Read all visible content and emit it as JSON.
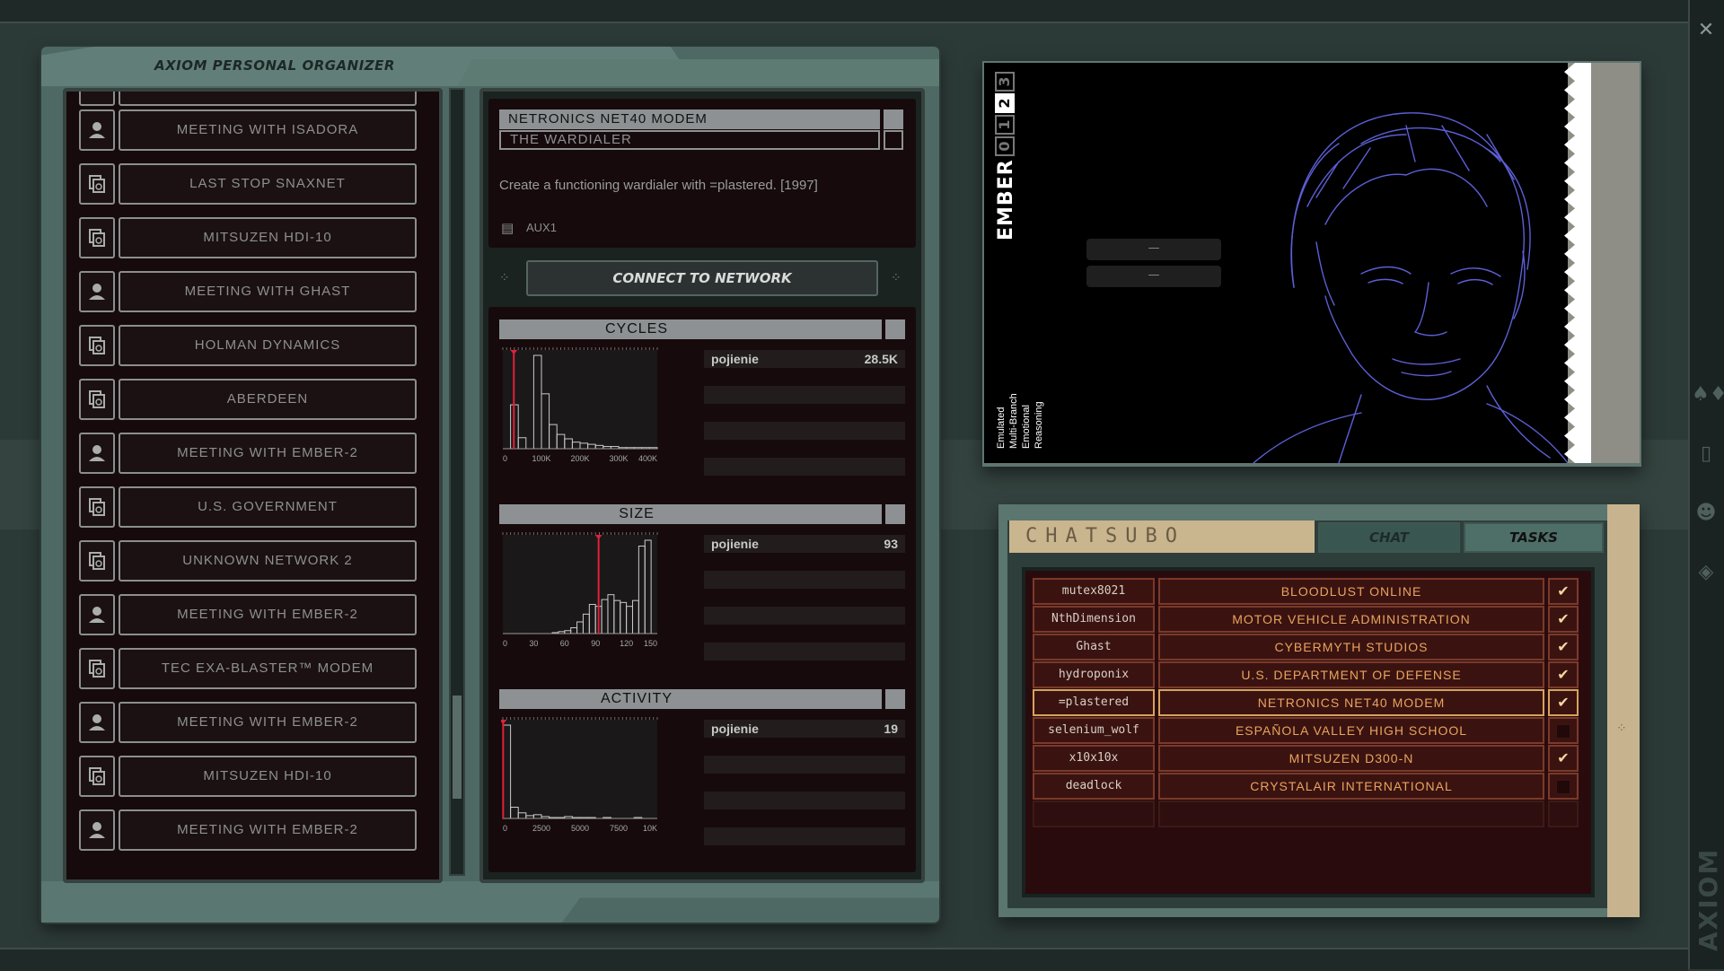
{
  "organizer": {
    "title": "AXIOM PERSONAL ORGANIZER",
    "items": [
      {
        "label": "MEETING WITH ISADORA",
        "icon": "person-icon"
      },
      {
        "label": "LAST STOP SNAXNET",
        "icon": "network-icon"
      },
      {
        "label": "MITSUZEN HDI-10",
        "icon": "network-icon"
      },
      {
        "label": "MEETING WITH GHAST",
        "icon": "person-icon"
      },
      {
        "label": "HOLMAN DYNAMICS",
        "icon": "network-icon"
      },
      {
        "label": "ABERDEEN",
        "icon": "network-icon"
      },
      {
        "label": "MEETING WITH EMBER-2",
        "icon": "person-icon"
      },
      {
        "label": "U.S. GOVERNMENT",
        "icon": "network-icon"
      },
      {
        "label": "UNKNOWN NETWORK 2",
        "icon": "network-icon"
      },
      {
        "label": "MEETING WITH EMBER-2",
        "icon": "person-icon"
      },
      {
        "label": "TEC EXA-BLASTER™ MODEM",
        "icon": "network-icon"
      },
      {
        "label": "MEETING WITH EMBER-2",
        "icon": "person-icon"
      },
      {
        "label": "MITSUZEN HDI-10",
        "icon": "network-icon"
      },
      {
        "label": "MEETING WITH EMBER-2",
        "icon": "person-icon"
      }
    ]
  },
  "task": {
    "selected": "NETRONICS NET40 MODEM",
    "secondary": "THE WARDIALER",
    "description": "Create a functioning wardialer with =plastered. [1997]",
    "aux": "AUX1",
    "connect_label": "CONNECT TO NETWORK"
  },
  "stats": {
    "cycles": {
      "title": "CYCLES",
      "name": "pojienie",
      "value": "28.5K"
    },
    "size": {
      "title": "SIZE",
      "name": "pojienie",
      "value": "93"
    },
    "activity": {
      "title": "ACTIVITY",
      "name": "pojienie",
      "value": "19"
    }
  },
  "chart_data": [
    {
      "type": "bar",
      "title": "CYCLES",
      "x_ticks": [
        "0",
        "100K",
        "200K",
        "300K",
        "400K"
      ],
      "xlim": [
        0,
        400000
      ],
      "bins": [
        0,
        40,
        10,
        0,
        85,
        50,
        22,
        13,
        9,
        6,
        5,
        4,
        3,
        2,
        2,
        1,
        1,
        1,
        1,
        1
      ],
      "marker": 28500
    },
    {
      "type": "bar",
      "title": "SIZE",
      "x_ticks": [
        "0",
        "30",
        "60",
        "90",
        "120",
        "150"
      ],
      "xlim": [
        0,
        150
      ],
      "bins": [
        0,
        0,
        0,
        0,
        0,
        0,
        0,
        0,
        1,
        2,
        3,
        6,
        12,
        20,
        30,
        28,
        35,
        40,
        34,
        32,
        28,
        34,
        90,
        96,
        0
      ],
      "marker": 93
    },
    {
      "type": "bar",
      "title": "ACTIVITY",
      "x_ticks": [
        "0",
        "2500",
        "5000",
        "7500",
        "10K"
      ],
      "xlim": [
        0,
        10000
      ],
      "bins": [
        100,
        12,
        6,
        3,
        4,
        2,
        1,
        1,
        2,
        1,
        1,
        1,
        0,
        1,
        0,
        0,
        0,
        1,
        0,
        0
      ],
      "marker": 19
    }
  ],
  "ember": {
    "name": "EMBER",
    "versions": [
      "0",
      "1",
      "2",
      "3"
    ],
    "active_version": "2",
    "traits": [
      "Emulated",
      "Multi-Branch",
      "Emotional",
      "Reasoning"
    ],
    "dash1": "—",
    "dash2": "—"
  },
  "chatsubo": {
    "title": "CHATSUBO",
    "tab_chat": "CHAT",
    "tab_tasks": "TASKS",
    "tasks": [
      {
        "user": "mutex8021",
        "target": "BLOODLUST ONLINE",
        "done": true
      },
      {
        "user": "NthDimension",
        "target": "MOTOR VEHICLE ADMINISTRATION",
        "done": true
      },
      {
        "user": "Ghast",
        "target": "CYBERMYTH STUDIOS",
        "done": true
      },
      {
        "user": "hydroponix",
        "target": "U.S. DEPARTMENT OF DEFENSE",
        "done": true
      },
      {
        "user": "=plastered",
        "target": "NETRONICS NET40 MODEM",
        "done": true,
        "selected": true
      },
      {
        "user": "selenium_wolf",
        "target": "ESPAÑOLA VALLEY HIGH SCHOOL",
        "done": false
      },
      {
        "user": "x10x10x",
        "target": "MITSUZEN D300-N",
        "done": true
      },
      {
        "user": "deadlock",
        "target": "CRYSTALAIR INTERNATIONAL",
        "done": false
      }
    ],
    "check_glyph": "✔"
  },
  "dock": {
    "close_glyph": "✕",
    "brand": "AXIOM"
  },
  "colors": {
    "accent_orange": "#e9a35c",
    "marker_red": "#e0203a",
    "panel_teal": "#4e6963",
    "portrait_line": "#5c5fd6"
  }
}
